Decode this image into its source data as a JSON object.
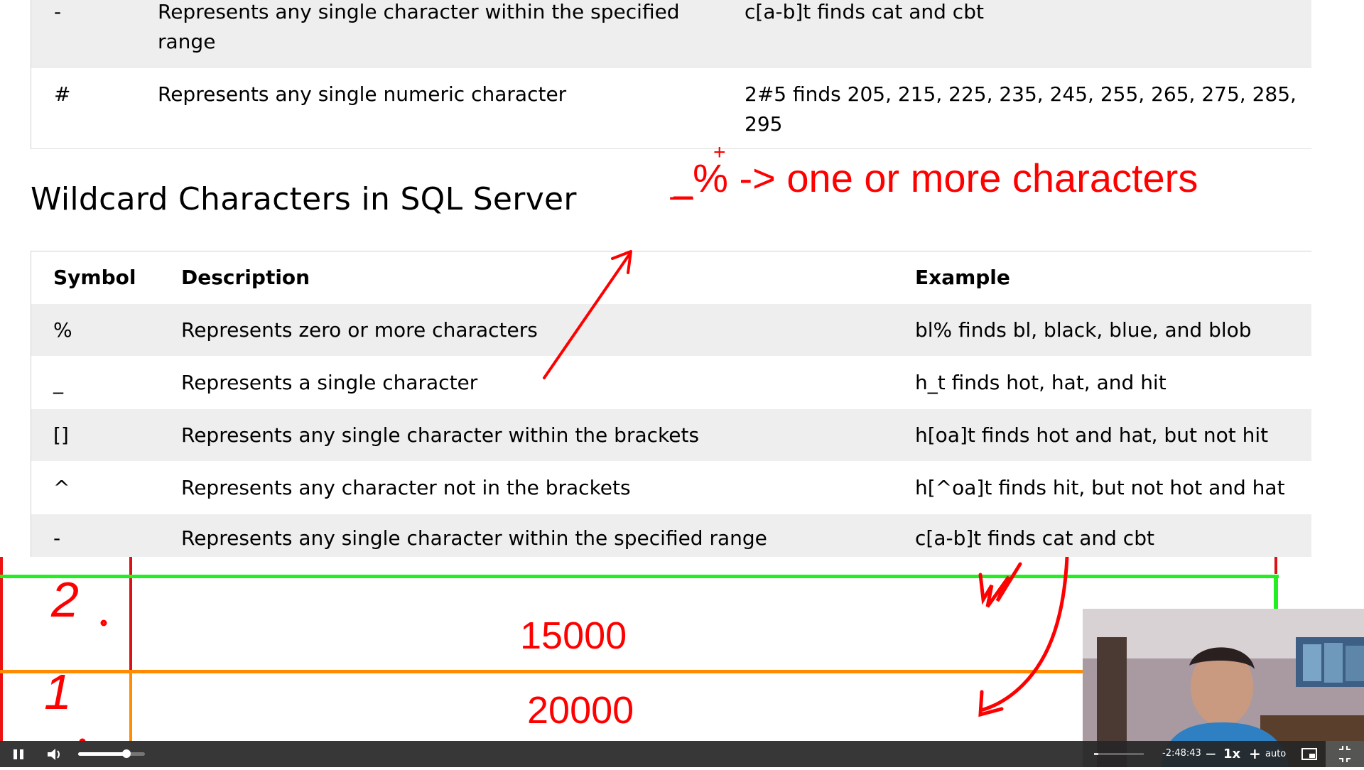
{
  "top_table": {
    "rows": [
      {
        "symbol": "-",
        "description_lines": [
          "Represents any single character within the specified",
          "range"
        ],
        "example_lines": [
          "c[a-b]t finds cat and cbt"
        ]
      },
      {
        "symbol": "#",
        "description_lines": [
          "Represents any single numeric character"
        ],
        "example_lines": [
          "2#5 finds 205, 215, 225, 235, 245, 255, 265, 275, 285,",
          "295"
        ]
      }
    ]
  },
  "section_title": "Wildcard Characters in SQL Server",
  "annotation": {
    "plus": "+",
    "text": "_% -> one or more characters"
  },
  "main_table": {
    "headers": {
      "symbol": "Symbol",
      "description": "Description",
      "example": "Example"
    },
    "rows": [
      {
        "symbol": "%",
        "description": "Represents zero or more characters",
        "example": "bl% finds bl, black, blue, and blob"
      },
      {
        "symbol": "_",
        "description": "Represents a single character",
        "example": "h_t finds hot, hat, and hit"
      },
      {
        "symbol": "[]",
        "description": "Represents any single character within the brackets",
        "example": "h[oa]t finds hot and hat, but not hit"
      },
      {
        "symbol": "^",
        "description": "Represents any character not in the brackets",
        "example": "h[^oa]t finds hit, but not hot and hat"
      },
      {
        "symbol": "-",
        "description": "Represents any single character within the specified range",
        "example": "c[a-b]t finds cat and cbt"
      }
    ]
  },
  "whiteboard": {
    "row1_id": "2",
    "row1_amount": "15000",
    "row2_id": "1",
    "row2_amount": "20000"
  },
  "player": {
    "time_remaining": "-2:48:43",
    "speed": "1x",
    "quality": "auto",
    "progress": 0.09,
    "volume": 0.72
  },
  "colors": {
    "annotation_red": "#ff0000",
    "row_gray": "#eeeeee",
    "line_green": "#22ee22",
    "line_orange": "#ff8c00"
  }
}
